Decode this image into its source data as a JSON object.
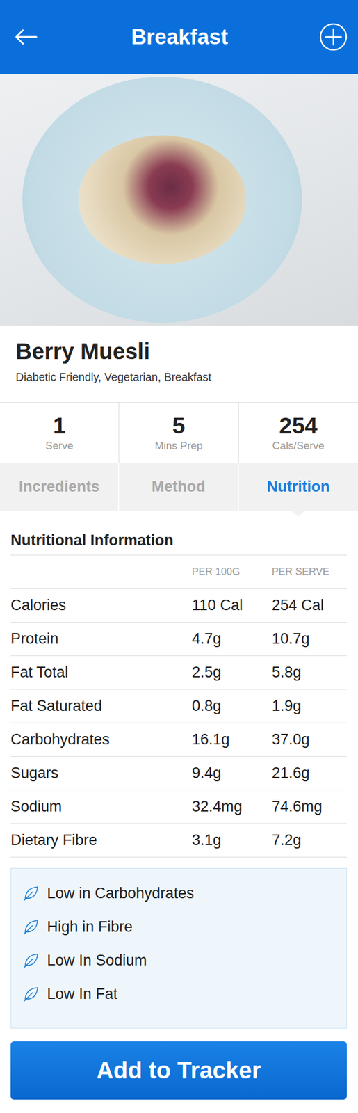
{
  "header": {
    "title": "Breakfast"
  },
  "recipe": {
    "name": "Berry Muesli",
    "tags": "Diabetic Friendly, Vegetarian, Breakfast"
  },
  "stats": [
    {
      "value": "1",
      "label": "Serve"
    },
    {
      "value": "5",
      "label": "Mins Prep"
    },
    {
      "value": "254",
      "label": "Cals/Serve"
    }
  ],
  "tabs": [
    {
      "label": "Incredients",
      "selected": false
    },
    {
      "label": "Method",
      "selected": false
    },
    {
      "label": "Nutrition",
      "selected": true
    }
  ],
  "nutrition": {
    "title": "Nutritional Information",
    "columns": [
      "PER 100G",
      "PER SERVE"
    ],
    "rows": [
      {
        "name": "Calories",
        "per100g": "110 Cal",
        "perServe": "254 Cal"
      },
      {
        "name": "Protein",
        "per100g": "4.7g",
        "perServe": "10.7g"
      },
      {
        "name": "Fat Total",
        "per100g": "2.5g",
        "perServe": "5.8g"
      },
      {
        "name": "Fat Saturated",
        "per100g": "0.8g",
        "perServe": "1.9g"
      },
      {
        "name": "Carbohydrates",
        "per100g": "16.1g",
        "perServe": "37.0g"
      },
      {
        "name": "Sugars",
        "per100g": "9.4g",
        "perServe": "21.6g"
      },
      {
        "name": "Sodium",
        "per100g": "32.4mg",
        "perServe": "74.6mg"
      },
      {
        "name": "Dietary Fibre",
        "per100g": "3.1g",
        "perServe": "7.2g"
      }
    ]
  },
  "highlights": [
    "Low in Carbohydrates",
    "High in Fibre",
    "Low In Sodium",
    "Low In Fat"
  ],
  "button": {
    "label": "Add to Tracker"
  }
}
